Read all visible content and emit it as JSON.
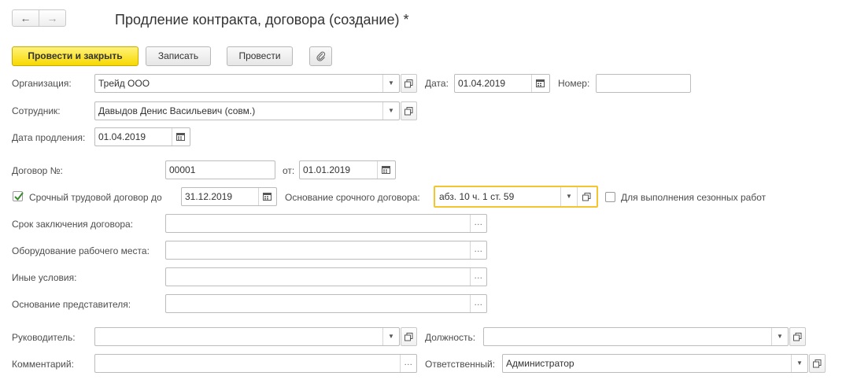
{
  "nav": {
    "back_icon": "←",
    "forward_icon": "→"
  },
  "window": {
    "title": "Продление контракта, договора (создание) *"
  },
  "toolbar": {
    "post_close_label": "Провести и закрыть",
    "write_label": "Записать",
    "post_label": "Провести"
  },
  "form": {
    "organization": {
      "label": "Организация:",
      "value": "Трейд ООО"
    },
    "date": {
      "label": "Дата:",
      "value": "01.04.2019"
    },
    "number": {
      "label": "Номер:",
      "value": ""
    },
    "employee": {
      "label": "Сотрудник:",
      "value": "Давыдов Денис Васильевич (совм.)"
    },
    "extension_date": {
      "label": "Дата продления:",
      "value": "01.04.2019"
    },
    "contract_no": {
      "label": "Договор №:",
      "value": "00001"
    },
    "contract_from": {
      "label": "от:",
      "value": "01.01.2019"
    },
    "fixed_term": {
      "label": "Срочный трудовой договор до",
      "checked": true,
      "value": "31.12.2019"
    },
    "fixed_basis": {
      "label": "Основание срочного договора:",
      "value": "абз. 10 ч. 1 ст. 59"
    },
    "seasonal": {
      "label": "Для выполнения сезонных работ",
      "checked": false
    },
    "term": {
      "label": "Срок заключения договора:",
      "value": ""
    },
    "equipment": {
      "label": "Оборудование рабочего места:",
      "value": ""
    },
    "other": {
      "label": "Иные условия:",
      "value": ""
    },
    "rep_basis": {
      "label": "Основание представителя:",
      "value": ""
    },
    "head": {
      "label": "Руководитель:",
      "value": ""
    },
    "position": {
      "label": "Должность:",
      "value": ""
    },
    "comment": {
      "label": "Комментарий:",
      "value": ""
    },
    "responsible": {
      "label": "Ответственный:",
      "value": "Администратор"
    }
  },
  "icons": {
    "dropdown": "▼",
    "ellipsis": "...",
    "calendar": "calendar-icon",
    "open": "open-icon",
    "attach": "paperclip-icon"
  },
  "colors": {
    "primary": "#f7d900",
    "focus": "#f2c531",
    "checkmark": "#3a8a2e"
  }
}
